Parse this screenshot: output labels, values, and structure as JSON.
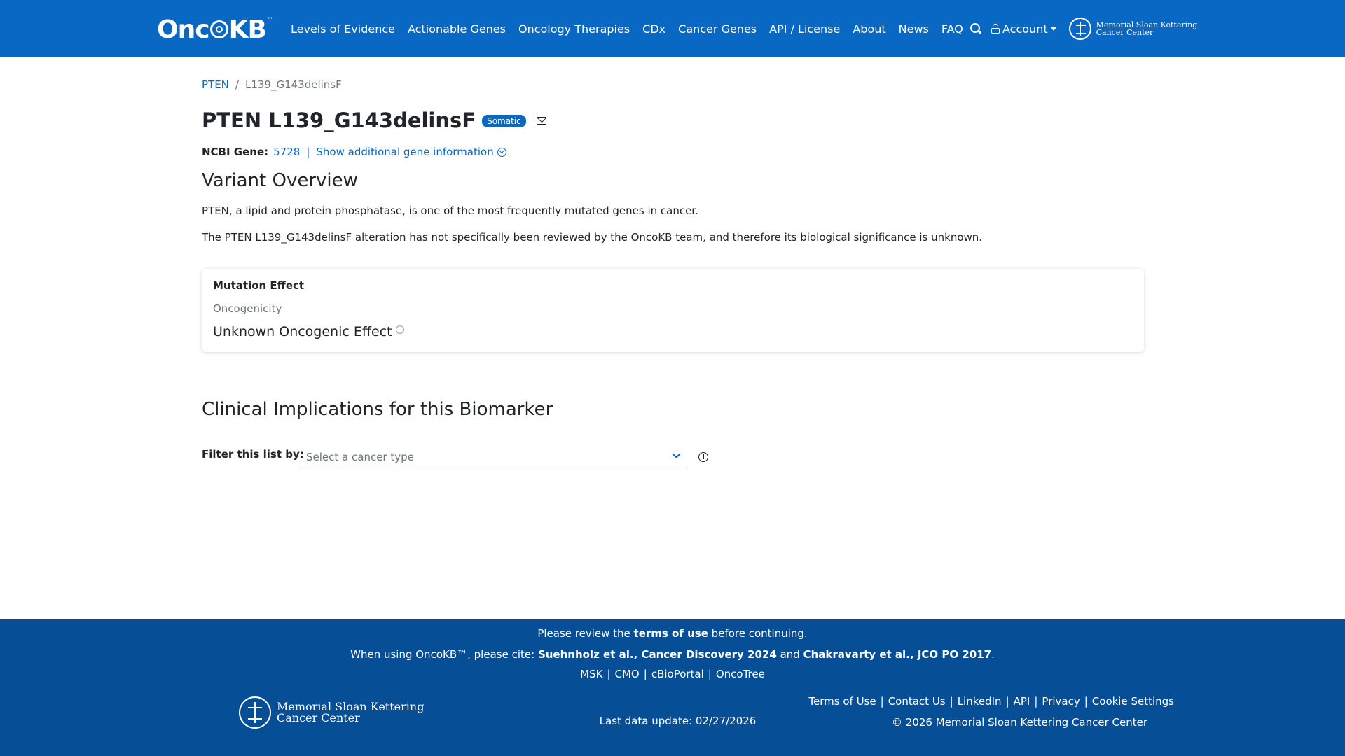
{
  "nav": {
    "logo": "OncoKB",
    "logo_tm": "™",
    "links": [
      "Levels of Evidence",
      "Actionable Genes",
      "Oncology Therapies",
      "CDx",
      "Cancer Genes",
      "API / License",
      "About",
      "News",
      "FAQ"
    ],
    "account": "Account",
    "msk_line1": "Memorial Sloan Kettering",
    "msk_line2": "Cancer Center"
  },
  "breadcrumb": {
    "gene": "PTEN",
    "separator": "/",
    "variant": "L139_G143delinsF"
  },
  "header": {
    "title": "PTEN L139_G143delinsF",
    "badge": "Somatic"
  },
  "gene_info": {
    "label": "NCBI Gene:",
    "id": "5728",
    "pipe": "|",
    "more_link": "Show additional gene information"
  },
  "overview": {
    "heading": "Variant Overview",
    "description": "PTEN, a lipid and protein phosphatase, is one of the most frequently mutated genes in cancer.",
    "summary": "The PTEN L139_G143delinsF alteration has not specifically been reviewed by the OncoKB team, and therefore its biological significance is unknown."
  },
  "mutation_effect": {
    "title": "Mutation Effect",
    "subtitle": "Oncogenicity",
    "value": "Unknown Oncogenic Effect"
  },
  "clinical": {
    "heading": "Clinical Implications for this Biomarker",
    "filter_label": "Filter this list by:",
    "select_placeholder": "Select a cancer type"
  },
  "footer": {
    "review_pre": "Please review the",
    "review_link": "terms of use",
    "review_post": "before continuing.",
    "cite_pre": "When using OncoKB™, please cite:",
    "cite1": "Suehnholz et al., Cancer Discovery 2024",
    "cite_and": "and",
    "cite2": "Chakravarty et al., JCO PO 2017",
    "cite_end": ".",
    "partner_links": [
      "MSK",
      "CMO",
      "cBioPortal",
      "OncoTree"
    ],
    "msk_line1": "Memorial Sloan Kettering",
    "msk_line2": "Cancer Center",
    "last_update": "Last data update: 02/27/2026",
    "legal_links": [
      "Terms of Use",
      "Contact Us",
      "LinkedIn",
      "API",
      "Privacy",
      "Cookie Settings"
    ],
    "copyright": "© 2026 Memorial Sloan Kettering Cancer Center"
  },
  "colors": {
    "primary": "#0968c3",
    "footer": "#064f97"
  }
}
